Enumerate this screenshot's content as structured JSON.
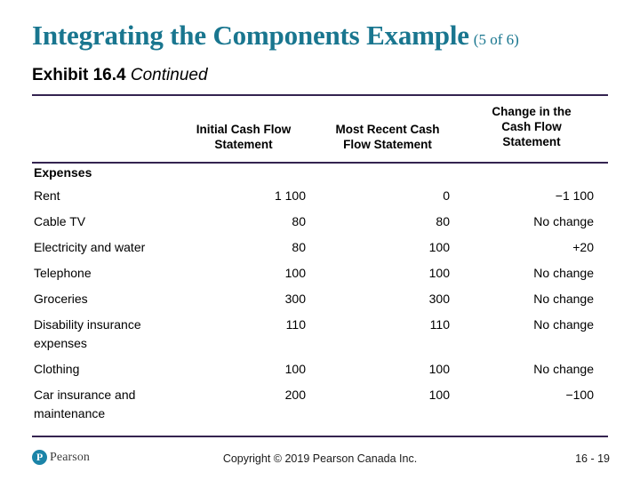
{
  "slide": {
    "title": "Integrating the Components Example",
    "title_suffix": "(5 of 6)",
    "subtitle_strong": "Exhibit 16.4",
    "subtitle_em": "Continued",
    "accent_teal": "#19768f",
    "rule_color": "#342350"
  },
  "table": {
    "headers": [
      "Initial Cash Flow Statement",
      "Most Recent Cash Flow Statement",
      "Change in the Cash Flow Statement"
    ],
    "header_lines": [
      [
        "Initial Cash Flow",
        "Statement"
      ],
      [
        "Most Recent Cash",
        "Flow Statement"
      ],
      [
        "Change in the",
        "Cash Flow",
        "Statement"
      ]
    ],
    "section_label": "Expenses",
    "rows": [
      {
        "label": "Rent",
        "initial": "1 100",
        "recent": "0",
        "change": "−1 100"
      },
      {
        "label": "Cable TV",
        "initial": "80",
        "recent": "80",
        "change": "No change"
      },
      {
        "label": "Electricity and water",
        "initial": "80",
        "recent": "100",
        "change": "+20"
      },
      {
        "label": "Telephone",
        "initial": "100",
        "recent": "100",
        "change": "No change"
      },
      {
        "label": "Groceries",
        "initial": "300",
        "recent": "300",
        "change": "No change"
      },
      {
        "label": "Disability insurance expenses",
        "initial": "110",
        "recent": "110",
        "change": "No change"
      },
      {
        "label": "Clothing",
        "initial": "100",
        "recent": "100",
        "change": "No change"
      },
      {
        "label": "Car insurance and maintenance",
        "initial": "200",
        "recent": "100",
        "change": "−100"
      }
    ]
  },
  "footer": {
    "logo_mark": "P",
    "logo_word": "Pearson",
    "copyright": "Copyright © 2019 Pearson Canada Inc.",
    "page_number": "16 - 19"
  }
}
